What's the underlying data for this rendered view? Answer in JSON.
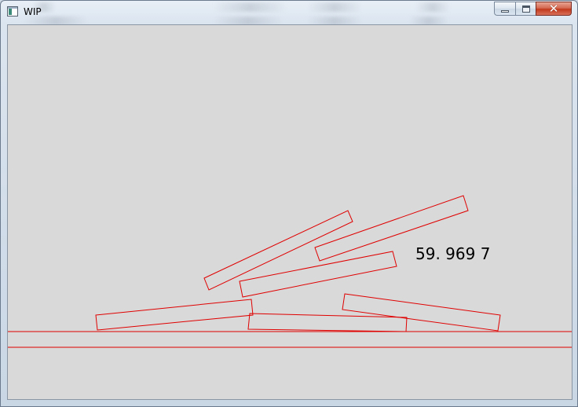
{
  "window": {
    "title": "WIP",
    "icon": "app-window-icon",
    "buttons": {
      "minimize_icon": "minimize-icon",
      "maximize_icon": "maximize-icon",
      "close_glyph": "✕"
    }
  },
  "scene": {
    "readout": "59. 969  7",
    "background_color": "#d9d9d9",
    "outline_color": "#e00000"
  }
}
